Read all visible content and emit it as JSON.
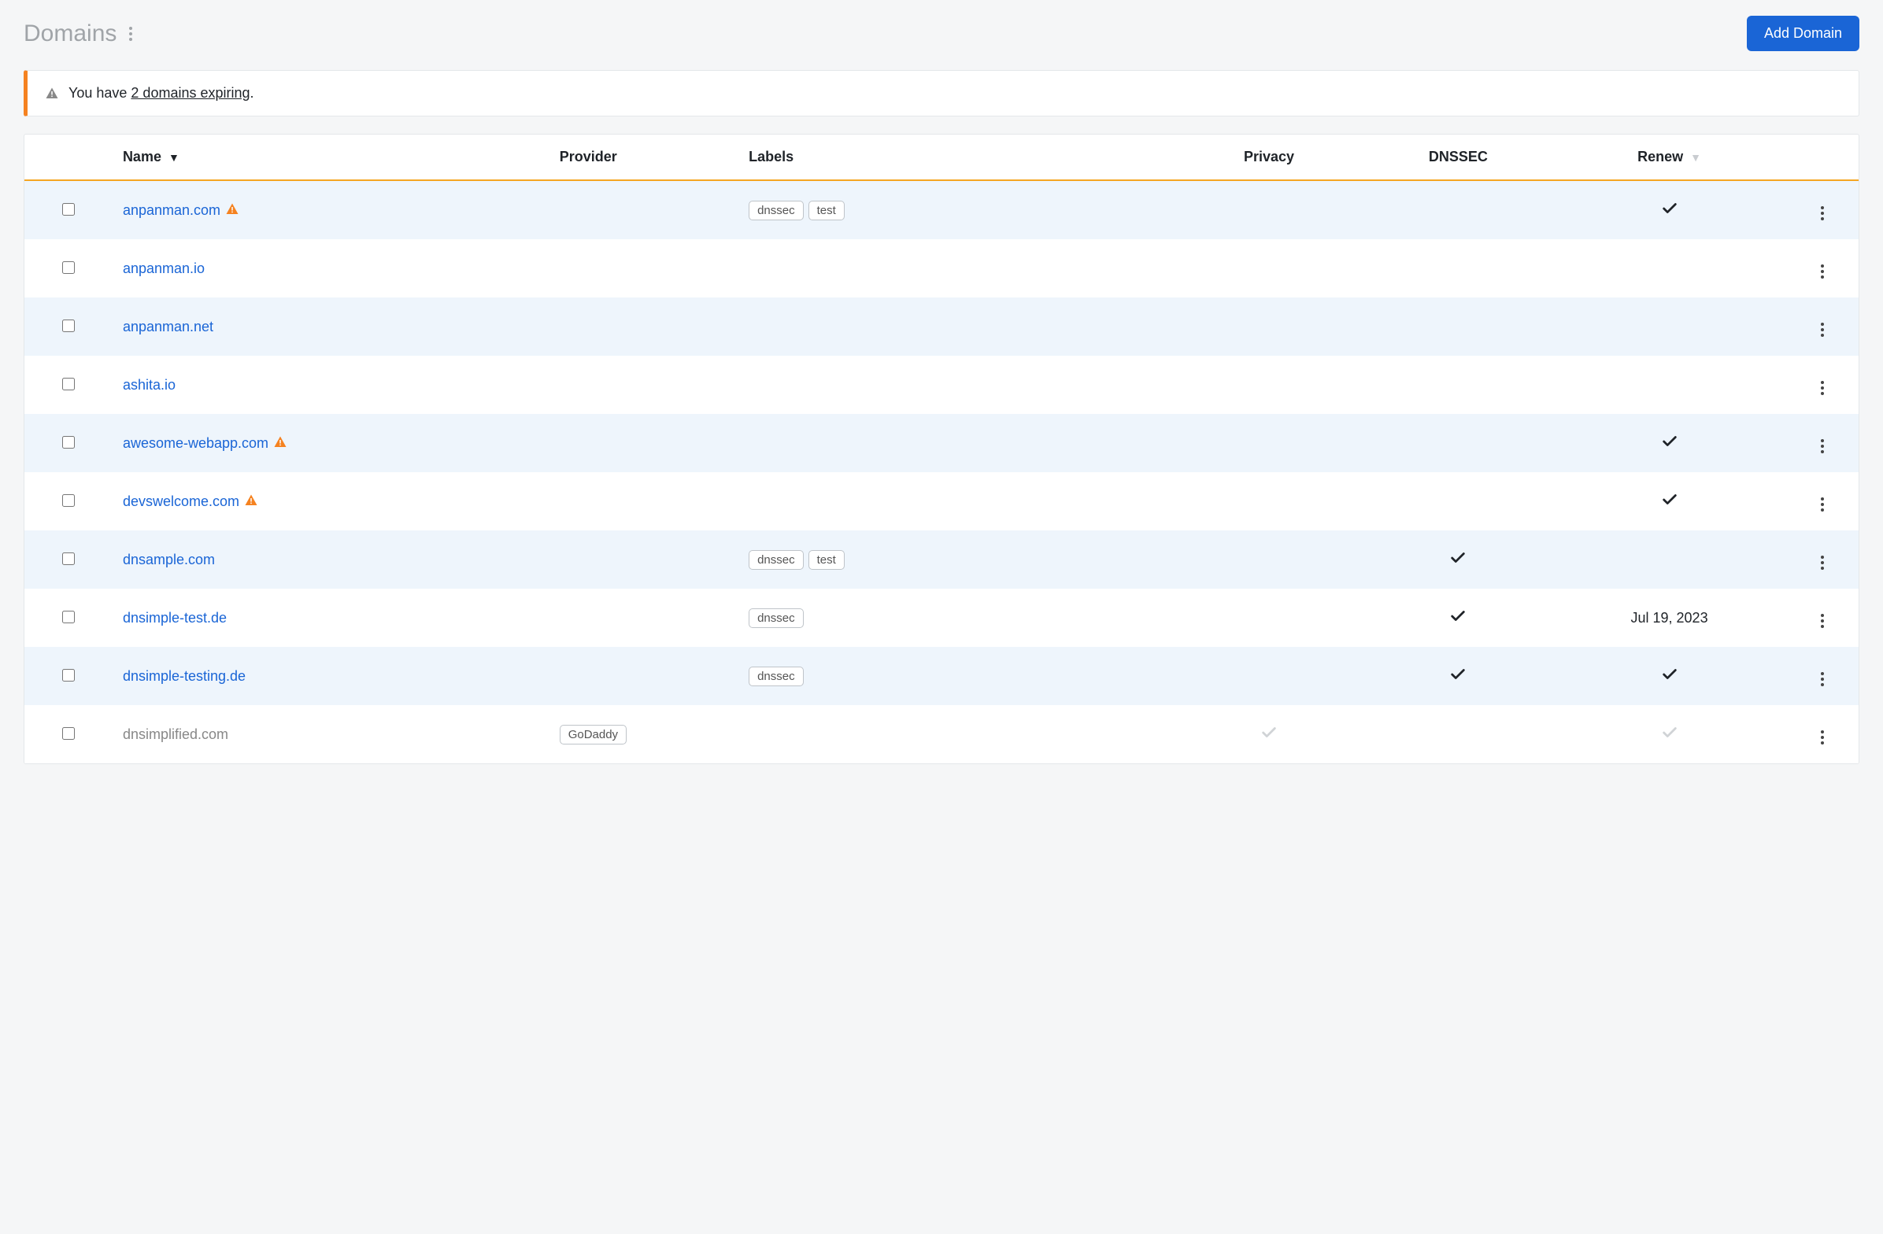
{
  "title": "Domains",
  "add_button": "Add Domain",
  "alert": {
    "prefix": "You have ",
    "link": "2 domains expiring",
    "suffix": "."
  },
  "columns": {
    "name": "Name",
    "provider": "Provider",
    "labels": "Labels",
    "privacy": "Privacy",
    "dnssec": "DNSSEC",
    "renew": "Renew"
  },
  "sort": {
    "name_indicator": "▼"
  },
  "label_texts": {
    "dnssec": "dnssec",
    "test": "test",
    "godaddy": "GoDaddy"
  },
  "rows": [
    {
      "name": "anpanman.com",
      "active": true,
      "warn": true,
      "labels": [
        "dnssec",
        "test"
      ],
      "dnssec": false,
      "renew_check": true,
      "renew_text": ""
    },
    {
      "name": "anpanman.io",
      "active": true,
      "warn": false,
      "labels": [],
      "dnssec": false,
      "renew_check": false,
      "renew_text": ""
    },
    {
      "name": "anpanman.net",
      "active": true,
      "warn": false,
      "labels": [],
      "dnssec": false,
      "renew_check": false,
      "renew_text": ""
    },
    {
      "name": "ashita.io",
      "active": true,
      "warn": false,
      "labels": [],
      "dnssec": false,
      "renew_check": false,
      "renew_text": ""
    },
    {
      "name": "awesome-webapp.com",
      "active": true,
      "warn": true,
      "labels": [],
      "dnssec": false,
      "renew_check": true,
      "renew_text": ""
    },
    {
      "name": "devswelcome.com",
      "active": true,
      "warn": true,
      "labels": [],
      "dnssec": false,
      "renew_check": true,
      "renew_text": ""
    },
    {
      "name": "dnsample.com",
      "active": true,
      "warn": false,
      "labels": [
        "dnssec",
        "test"
      ],
      "dnssec": true,
      "renew_check": false,
      "renew_text": ""
    },
    {
      "name": "dnsimple-test.de",
      "active": true,
      "warn": false,
      "labels": [
        "dnssec"
      ],
      "dnssec": true,
      "renew_check": false,
      "renew_text": "Jul 19, 2023"
    },
    {
      "name": "dnsimple-testing.de",
      "active": true,
      "warn": false,
      "labels": [
        "dnssec"
      ],
      "dnssec": true,
      "renew_check": true,
      "renew_text": ""
    },
    {
      "name": "dnsimplified.com",
      "active": false,
      "warn": false,
      "provider": "GoDaddy",
      "labels": [],
      "dnssec": false,
      "renew_check": false,
      "renew_text": "",
      "privacy_grey": true,
      "renew_grey": true
    }
  ]
}
